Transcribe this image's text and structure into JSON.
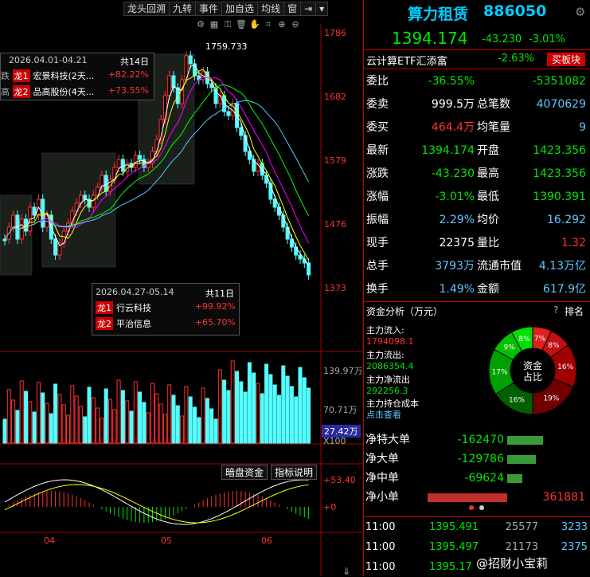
{
  "toolbar": [
    "龙头回溯",
    "九转",
    "事件",
    "加自选",
    "均线",
    "窗"
  ],
  "toolbar_icons": [
    "double-arrow-icon",
    "chevron-down-icon"
  ],
  "chart": {
    "price_labels": [
      "1786",
      "1682",
      "1579",
      "1476",
      "1373"
    ],
    "high_label": "1759.733",
    "vol_labels": [
      "139.97万",
      "70.71万"
    ],
    "vol_current": "27.42万",
    "vol_unit": "X100",
    "macd_labels": [
      "+53.40",
      "+0"
    ],
    "date_labels": [
      "04",
      "05",
      "06"
    ],
    "buttons": [
      "暗盘资金",
      "指标说明"
    ]
  },
  "tip1": {
    "range": "2026.04.01-04.21",
    "days": "共14日",
    "items": [
      {
        "tag": "龙1",
        "name": "宏景科技(2天...",
        "pct": "+82.22%"
      },
      {
        "tag": "龙2",
        "name": "品高股份(4天...",
        "pct": "+73.55%"
      }
    ],
    "side": [
      "跌",
      "高",
      "跌"
    ]
  },
  "tip2": {
    "range": "2026.04.27-05.14",
    "days": "共11日",
    "items": [
      {
        "tag": "龙1",
        "name": "行云科技",
        "pct": "+99.92%"
      },
      {
        "tag": "龙2",
        "name": "平治信息",
        "pct": "+65.70%"
      }
    ]
  },
  "quote": {
    "name": "算力租赁",
    "code": "886050",
    "price": "1394.174",
    "chg": "-43.230",
    "pct": "-3.01%",
    "etf": "云计算ETF汇添富",
    "etf_pct": "-2.63%",
    "buy_btn": "买板块",
    "rows": [
      [
        "委比",
        "-36.55%",
        "",
        "-5351082"
      ],
      [
        "委卖",
        "999.5万",
        "总笔数",
        "4070629"
      ],
      [
        "委买",
        "464.4万",
        "均笔量",
        "9"
      ],
      [
        "最新",
        "1394.174",
        "开盘",
        "1423.356"
      ],
      [
        "涨跌",
        "-43.230",
        "最高",
        "1423.356"
      ],
      [
        "涨幅",
        "-3.01%",
        "最低",
        "1390.391"
      ],
      [
        "振幅",
        "2.29%",
        "均价",
        "16.292"
      ],
      [
        "现手",
        "22375",
        "量比",
        "1.32"
      ],
      [
        "总手",
        "3793万",
        "流通市值",
        "4.13万亿"
      ],
      [
        "换手",
        "1.49%",
        "金额",
        "617.9亿"
      ]
    ]
  },
  "fund": {
    "title": "资金分析（万元）",
    "rank": "排名",
    "q": "?",
    "in_label": "主力流入:",
    "in_val": "1794098.1",
    "out_label": "主力流出:",
    "out_val": "2086354.4",
    "net_label": "主力净流出",
    "net_val": "292256.3",
    "hold": "主力持仓成本",
    "view": "点击查看",
    "donut_center": [
      "资金",
      "占比"
    ],
    "slices": [
      {
        "pct": "7%",
        "color": "#e02020"
      },
      {
        "pct": "8%",
        "color": "#c01010"
      },
      {
        "pct": "16%",
        "color": "#a00000"
      },
      {
        "pct": "19%",
        "color": "#700000"
      },
      {
        "pct": "16%",
        "color": "#006000"
      },
      {
        "pct": "17%",
        "color": "#00a000"
      },
      {
        "pct": "9%",
        "color": "#00c000"
      },
      {
        "pct": "8%",
        "color": "#00e000"
      }
    ]
  },
  "net": [
    {
      "label": "净特大单",
      "val": "-162470",
      "bar": 0.45,
      "color": "#3a9a3a"
    },
    {
      "label": "净大单",
      "val": "-129786",
      "bar": 0.36,
      "color": "#3a9a3a"
    },
    {
      "label": "净中单",
      "val": "-69624",
      "bar": 0.19,
      "color": "#3a9a3a"
    },
    {
      "label": "净小单",
      "val": "361881",
      "bar": 1.0,
      "color": "#c0302a"
    }
  ],
  "ticks": [
    {
      "t": "11:00",
      "p": "1395.491",
      "v": "25577",
      "a": "3233"
    },
    {
      "t": "11:00",
      "p": "1395.497",
      "v": "21173",
      "a": "2375"
    },
    {
      "t": "11:00",
      "p": "1395.17",
      "v": "",
      "a": ""
    }
  ],
  "watermark": "@招财小宝莉"
}
